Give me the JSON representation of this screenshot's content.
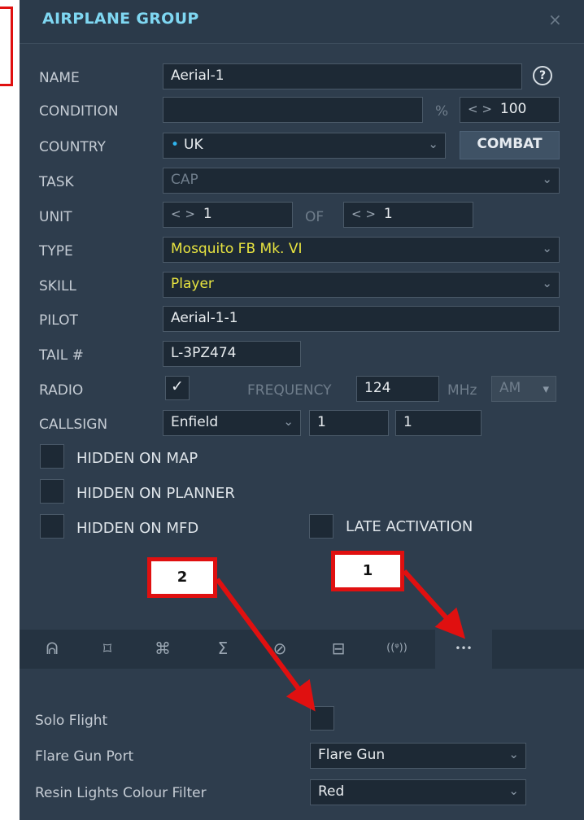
{
  "dialog": {
    "title": "AIRPLANE GROUP",
    "close_glyph": "×",
    "help_glyph": "?"
  },
  "form": {
    "name_label": "NAME",
    "name_value": "Aerial-1",
    "condition_label": "CONDITION",
    "condition_value": "",
    "percent_unit": "%",
    "condition_spin": "< >",
    "condition_percent": "100",
    "country_label": "COUNTRY",
    "country_dot": "•",
    "country_value": "UK",
    "combat_button": "COMBAT",
    "task_label": "TASK",
    "task_value": "CAP",
    "unit_label": "UNIT",
    "unit_spin": "< >",
    "unit_value": "1",
    "of_label": "OF",
    "of_spin": "< >",
    "of_value": "1",
    "type_label": "TYPE",
    "type_value": "Mosquito FB Mk. VI",
    "skill_label": "SKILL",
    "skill_value": "Player",
    "pilot_label": "PILOT",
    "pilot_value": "Aerial-1-1",
    "tail_label": "TAIL #",
    "tail_value": "L-3PZ474",
    "radio_label": "RADIO",
    "radio_checked": true,
    "frequency_label": "FREQUENCY",
    "frequency_value": "124",
    "mhz_unit": "MHz",
    "modulation_value": "AM",
    "callsign_label": "CALLSIGN",
    "callsign_value": "Enfield",
    "callsign_num1": "1",
    "callsign_num2": "1",
    "hidden_on_map": "HIDDEN ON MAP",
    "hidden_on_planner": "HIDDEN ON PLANNER",
    "hidden_on_mfd": "HIDDEN ON MFD",
    "late_activation": "LATE ACTIVATION"
  },
  "tabs": [
    {
      "icon": "waypoints-icon",
      "glyph": "ᕱ"
    },
    {
      "icon": "target-icon",
      "glyph": "⌑"
    },
    {
      "icon": "command-icon",
      "glyph": "⌘"
    },
    {
      "icon": "sum-icon",
      "glyph": "Σ"
    },
    {
      "icon": "prohibited-icon",
      "glyph": "⊘"
    },
    {
      "icon": "payload-icon",
      "glyph": "⊟"
    },
    {
      "icon": "radio-icon",
      "glyph": "((ᵠ))"
    },
    {
      "icon": "more-icon",
      "glyph": "•••"
    }
  ],
  "additional": {
    "solo_flight_label": "Solo Flight",
    "flare_gun_port_label": "Flare Gun Port",
    "flare_gun_port_value": "Flare Gun",
    "resin_lights_label": "Resin Lights Colour Filter",
    "resin_lights_value": "Red"
  },
  "callouts": {
    "one": "1",
    "two": "2"
  },
  "colors": {
    "accent_title": "#7fd7f2",
    "panel_bg": "#2e3d4d",
    "field_bg": "#1d2935",
    "highlight_text": "#e8e440",
    "callout_red": "#e01010"
  }
}
